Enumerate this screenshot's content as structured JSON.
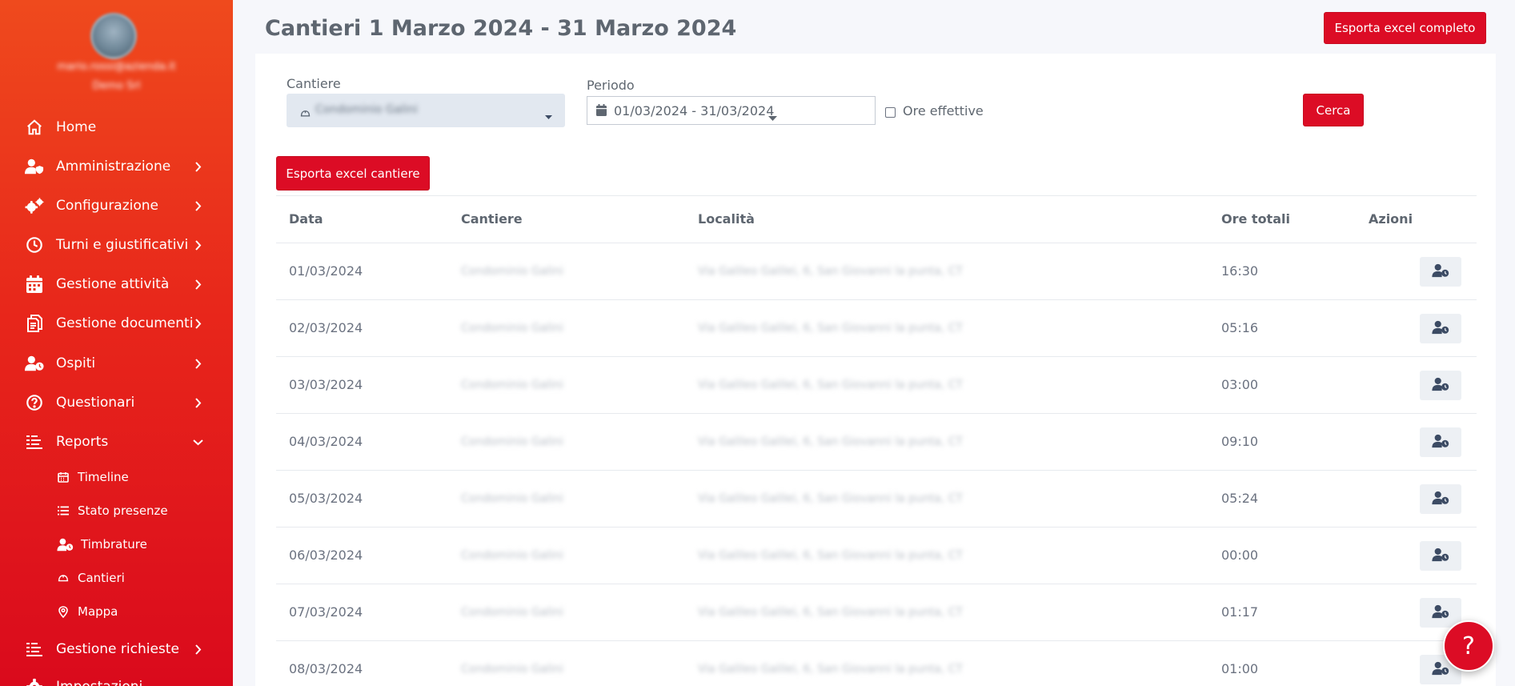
{
  "sidebar": {
    "user_email": "mario.rossi@azienda.it",
    "user_org": "Demo Srl",
    "items": [
      {
        "label": "Home",
        "icon": "home-icon"
      },
      {
        "label": "Amministrazione",
        "icon": "user-shield-icon"
      },
      {
        "label": "Configurazione",
        "icon": "gears-icon"
      },
      {
        "label": "Turni e giustificativi",
        "icon": "clock-icon"
      },
      {
        "label": "Gestione attività",
        "icon": "calendar-icon"
      },
      {
        "label": "Gestione documenti",
        "icon": "document-icon"
      },
      {
        "label": "Ospiti",
        "icon": "user-clock-icon"
      },
      {
        "label": "Questionari",
        "icon": "question-circle-icon"
      },
      {
        "label": "Reports",
        "icon": "report-list-icon"
      },
      {
        "label": "Gestione richieste",
        "icon": "report-list-icon"
      },
      {
        "label": "Impostazioni",
        "icon": "gear-icon"
      }
    ],
    "reports_sub": [
      {
        "label": "Timeline",
        "icon": "calendar-small-icon"
      },
      {
        "label": "Stato presenze",
        "icon": "list-icon"
      },
      {
        "label": "Timbrature",
        "icon": "user-clock-icon"
      },
      {
        "label": "Cantieri",
        "icon": "helmet-icon"
      },
      {
        "label": "Mappa",
        "icon": "map-pin-icon"
      }
    ]
  },
  "header": {
    "title": "Cantieri 1 Marzo 2024 - 31 Marzo 2024",
    "export_full_label": "Esporta excel completo"
  },
  "filters": {
    "cantiere_label": "Cantiere",
    "cantiere_value": "Condominio Galini",
    "periodo_label": "Periodo",
    "periodo_value": "01/03/2024 - 31/03/2024",
    "ore_effettive_label": "Ore effettive",
    "ore_effettive_checked": false,
    "search_label": "Cerca",
    "export_cantiere_label": "Esporta excel cantiere"
  },
  "table": {
    "columns": [
      "Data",
      "Cantiere",
      "Località",
      "Ore totali",
      "Azioni"
    ],
    "rows": [
      {
        "data": "01/03/2024",
        "cantiere": "Condominio Galini",
        "localita": "Via Galileo Galilei, 6, San Giovanni la punta, CT",
        "ore": "16:30"
      },
      {
        "data": "02/03/2024",
        "cantiere": "Condominio Galini",
        "localita": "Via Galileo Galilei, 6, San Giovanni la punta, CT",
        "ore": "05:16"
      },
      {
        "data": "03/03/2024",
        "cantiere": "Condominio Galini",
        "localita": "Via Galileo Galilei, 6, San Giovanni la punta, CT",
        "ore": "03:00"
      },
      {
        "data": "04/03/2024",
        "cantiere": "Condominio Galini",
        "localita": "Via Galileo Galilei, 6, San Giovanni la punta, CT",
        "ore": "09:10"
      },
      {
        "data": "05/03/2024",
        "cantiere": "Condominio Galini",
        "localita": "Via Galileo Galilei, 6, San Giovanni la punta, CT",
        "ore": "05:24"
      },
      {
        "data": "06/03/2024",
        "cantiere": "Condominio Galini",
        "localita": "Via Galileo Galilei, 6, San Giovanni la punta, CT",
        "ore": "00:00"
      },
      {
        "data": "07/03/2024",
        "cantiere": "Condominio Galini",
        "localita": "Via Galileo Galilei, 6, San Giovanni la punta, CT",
        "ore": "01:17"
      },
      {
        "data": "08/03/2024",
        "cantiere": "Condominio Galini",
        "localita": "Via Galileo Galilei, 6, San Giovanni la punta, CT",
        "ore": "01:00"
      }
    ]
  },
  "help_label": "?",
  "colors": {
    "accent": "#dc0c25",
    "sidebar_top": "#ef4a1d",
    "sidebar_bottom": "#da0a1c"
  }
}
